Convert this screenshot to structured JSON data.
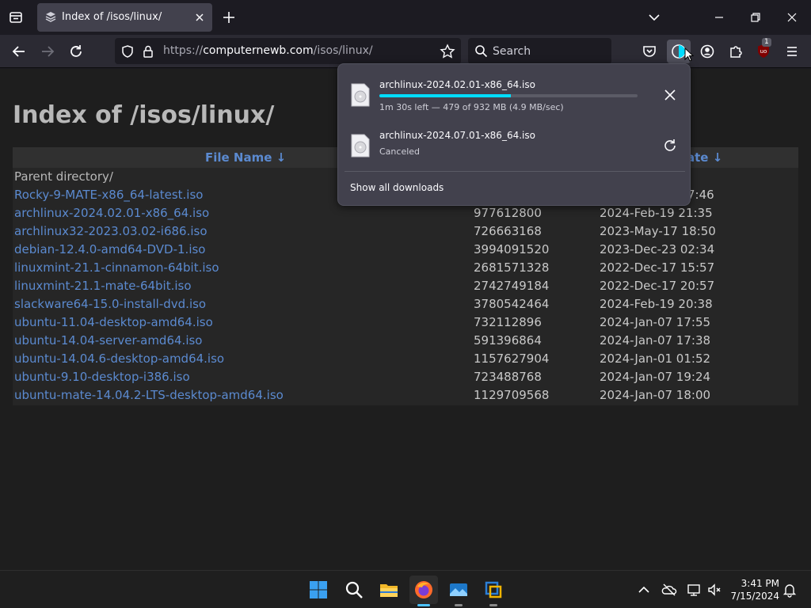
{
  "browser": {
    "tab": {
      "title": "Index of /isos/linux/"
    },
    "url": {
      "prefix": "https://",
      "host": "computernewb.com",
      "path": "/isos/linux/"
    },
    "search": {
      "placeholder": "Search"
    },
    "extension_badge": "1"
  },
  "page": {
    "title": "Index of /isos/linux/",
    "columns": {
      "name": "File Name  ↓",
      "date_partial": "ate  ↓"
    },
    "parent_directory": "Parent directory/",
    "rows": [
      {
        "name": "Rocky-9-MATE-x86_64-latest.iso",
        "size": "",
        "date": "",
        "date_partial": "7:46"
      },
      {
        "name": "archlinux-2024.02.01-x86_64.iso",
        "size": "977612800",
        "date": "2024-Feb-19 21:35"
      },
      {
        "name": "archlinux32-2023.03.02-i686.iso",
        "size": "726663168",
        "date": "2023-May-17 18:50"
      },
      {
        "name": "debian-12.4.0-amd64-DVD-1.iso",
        "size": "3994091520",
        "date": "2023-Dec-23 02:34"
      },
      {
        "name": "linuxmint-21.1-cinnamon-64bit.iso",
        "size": "2681571328",
        "date": "2022-Dec-17 15:57"
      },
      {
        "name": "linuxmint-21.1-mate-64bit.iso",
        "size": "2742749184",
        "date": "2022-Dec-17 20:57"
      },
      {
        "name": "slackware64-15.0-install-dvd.iso",
        "size": "3780542464",
        "date": "2024-Feb-19 20:38"
      },
      {
        "name": "ubuntu-11.04-desktop-amd64.iso",
        "size": "732112896",
        "date": "2024-Jan-07 17:55"
      },
      {
        "name": "ubuntu-14.04-server-amd64.iso",
        "size": "591396864",
        "date": "2024-Jan-07 17:38"
      },
      {
        "name": "ubuntu-14.04.6-desktop-amd64.iso",
        "size": "1157627904",
        "date": "2024-Jan-01 01:52"
      },
      {
        "name": "ubuntu-9.10-desktop-i386.iso",
        "size": "723488768",
        "date": "2024-Jan-07 19:24"
      },
      {
        "name": "ubuntu-mate-14.04.2-LTS-desktop-amd64.iso",
        "size": "1129709568",
        "date": "2024-Jan-07 18:00"
      }
    ]
  },
  "downloads": {
    "items": [
      {
        "name": "archlinux-2024.02.01-x86_64.iso",
        "status": "1m 30s left — 479 of 932 MB (4.9 MB/sec)",
        "progress": 0.51,
        "action": "cancel"
      },
      {
        "name": "archlinux-2024.07.01-x86_64.iso",
        "status": "Canceled",
        "action": "retry"
      }
    ],
    "show_all": "Show all downloads"
  },
  "taskbar": {
    "time": "3:41 PM",
    "date": "7/15/2024"
  },
  "colors": {
    "accent": "#00ddff",
    "link": "#5b8ad0",
    "ublock": "#800000"
  }
}
